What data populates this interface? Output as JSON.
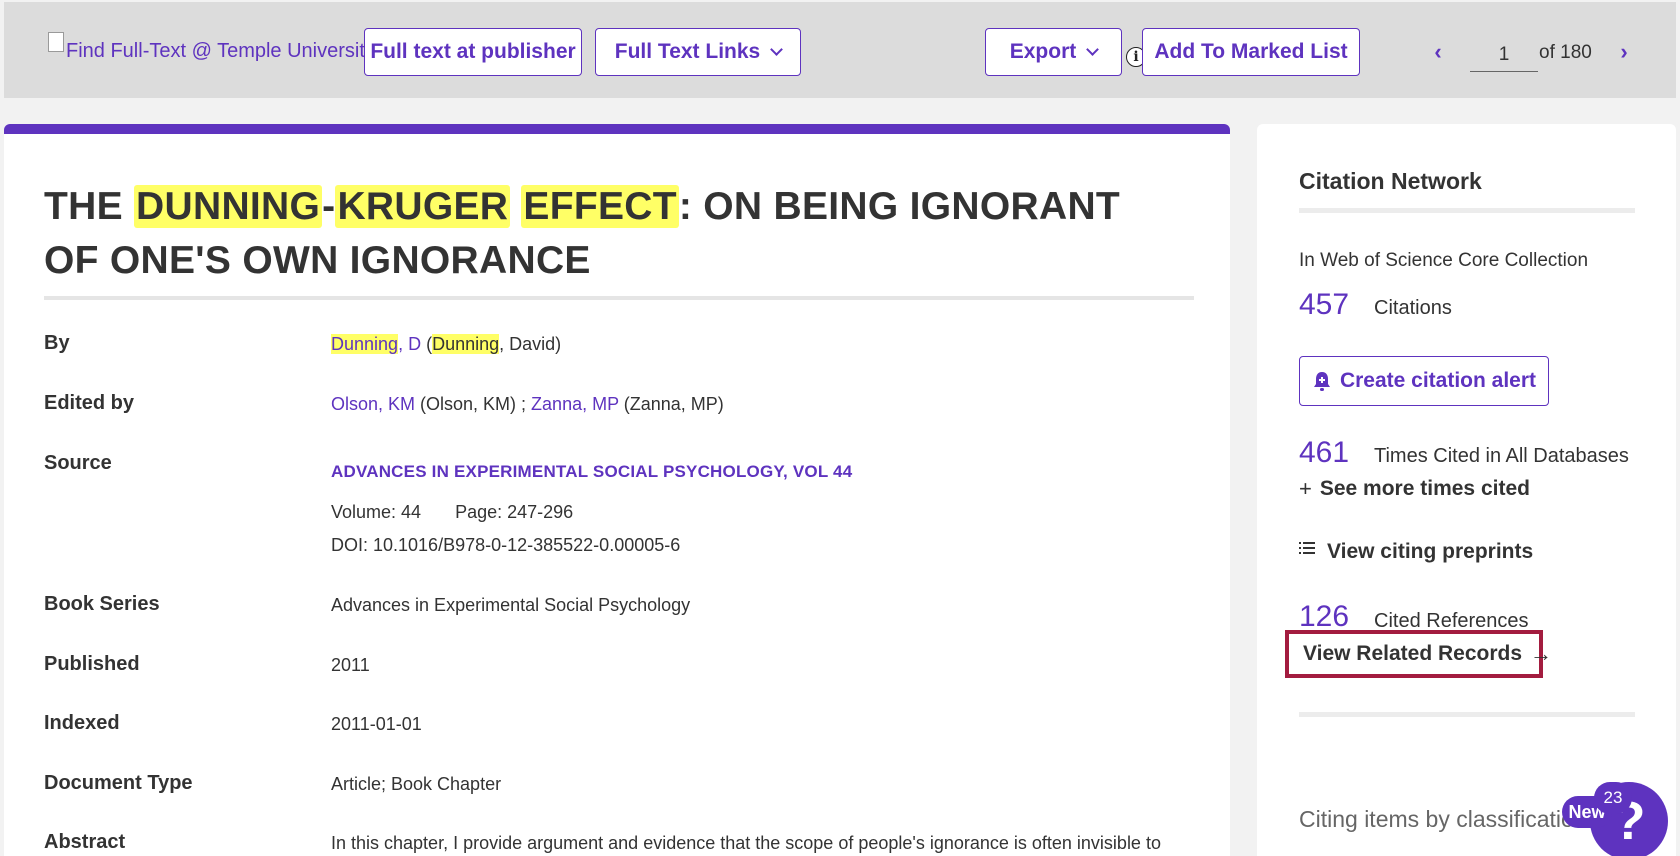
{
  "toolbar": {
    "find_fulltext_label": "Find Full-Text @ Temple University",
    "publisher_button": "Full text at publisher",
    "fulltext_links_button": "Full Text Links",
    "export_button": "Export",
    "info_icon": "i",
    "marked_list_button": "Add To Marked List",
    "pager": {
      "current": "1",
      "of_text": "of 180",
      "prev_glyph": "‹",
      "next_glyph": "›"
    }
  },
  "record": {
    "title_parts": [
      "THE ",
      "DUNNING",
      "-",
      "KRUGER",
      " ",
      "EFFECT",
      ": ON BEING IGNORANT OF ONE'S OWN IGNORANCE"
    ],
    "fields": {
      "by": {
        "label": "By",
        "author_hl": "Dunning",
        "author_rest": ", D",
        "paren_open": " (",
        "full_hl": "Dunning",
        "full_rest": ", David)"
      },
      "edited_by": {
        "label": "Edited by",
        "editor1_link": "Olson, KM",
        "editor1_full": " (Olson, KM) ; ",
        "editor2_link": "Zanna, MP",
        "editor2_full": " (Zanna, MP)"
      },
      "source": {
        "label": "Source",
        "journal": "ADVANCES IN EXPERIMENTAL SOCIAL PSYCHOLOGY, VOL 44",
        "volume": "Volume: 44",
        "page": "Page: 247-296",
        "doi": "DOI: 10.1016/B978-0-12-385522-0.00005-6"
      },
      "book_series": {
        "label": "Book Series",
        "value": "Advances in Experimental Social Psychology"
      },
      "published": {
        "label": "Published",
        "value": "2011"
      },
      "indexed": {
        "label": "Indexed",
        "value": "2011-01-01"
      },
      "document_type": {
        "label": "Document Type",
        "value": "Article; Book Chapter"
      },
      "abstract": {
        "label": "Abstract",
        "value": "In this chapter, I provide argument and evidence that the scope of people's ignorance is often invisible to"
      }
    }
  },
  "sidebar": {
    "title": "Citation Network",
    "collection_label": "In Web of Science Core Collection",
    "citations_count": "457",
    "citations_label": "Citations",
    "create_alert_button": "Create citation alert",
    "times_cited_count": "461",
    "times_cited_label": "Times Cited in All Databases",
    "see_more_label": "See more times cited",
    "plus_glyph": "+",
    "view_preprints_label": "View citing preprints",
    "cited_refs_count": "126",
    "cited_refs_label": "Cited References",
    "related_records_label": "View Related Records",
    "arrow_glyph": "→",
    "citing_classification_label": "Citing items by classification"
  },
  "help_widget": {
    "new_label": "New",
    "count": "23",
    "question_glyph": "?"
  },
  "colors": {
    "accent": "#5e33bf",
    "highlight": "#ffff66",
    "focus_box": "#a31c3f"
  }
}
